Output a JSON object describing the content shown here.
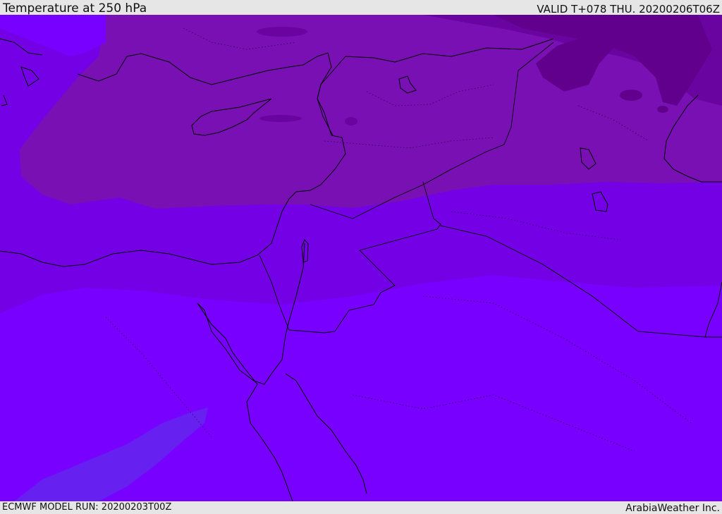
{
  "header": {
    "title": "Temperature at 250 hPa",
    "valid": "VALID T+078 THU. 20200206T06Z"
  },
  "footer": {
    "model_run": "ECMWF MODEL RUN: 20200203T00Z",
    "credit": "ArabiaWeather Inc."
  },
  "map": {
    "field": "temperature",
    "level": "250 hPa",
    "colors": {
      "warm_band": "#7800ff",
      "main_band": "#7810b4",
      "mid_band": "#7400e6",
      "cold_band": "#6a04a0",
      "coldest_band": "#62008e",
      "warm_patch": "#6620f0",
      "outline": "#000000"
    }
  }
}
